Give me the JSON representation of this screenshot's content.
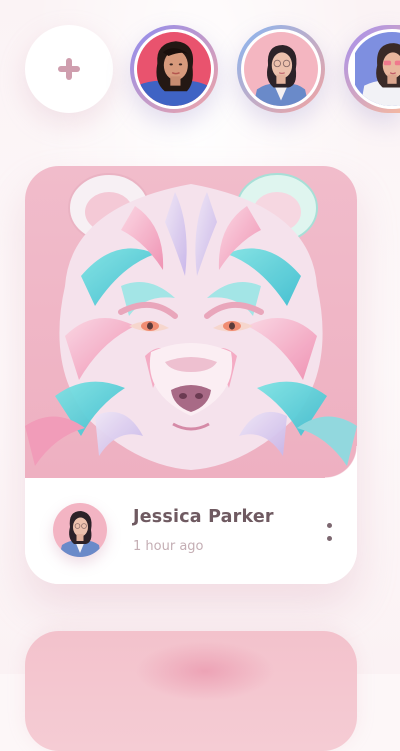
{
  "stories": {
    "add_label": "add-story",
    "items": [
      {
        "name": "story-1",
        "ring": [
          "#8e8cf0",
          "#f2a6a6"
        ]
      },
      {
        "name": "story-2",
        "ring": [
          "#86b6f3",
          "#f4a3a0"
        ]
      },
      {
        "name": "story-3",
        "ring": [
          "#a38ef0",
          "#f3b7a2"
        ]
      }
    ]
  },
  "post": {
    "author_name": "Jessica Parker",
    "time_ago": "1 hour ago",
    "art_subject": "paper-craft-bear-illustration",
    "colors": {
      "art_background": "#f2bfcb",
      "accent_teal": "#4fd3d8",
      "accent_pink": "#f19ab8"
    }
  },
  "icons": {
    "add": "plus-icon",
    "more": "more-vertical-icon"
  }
}
